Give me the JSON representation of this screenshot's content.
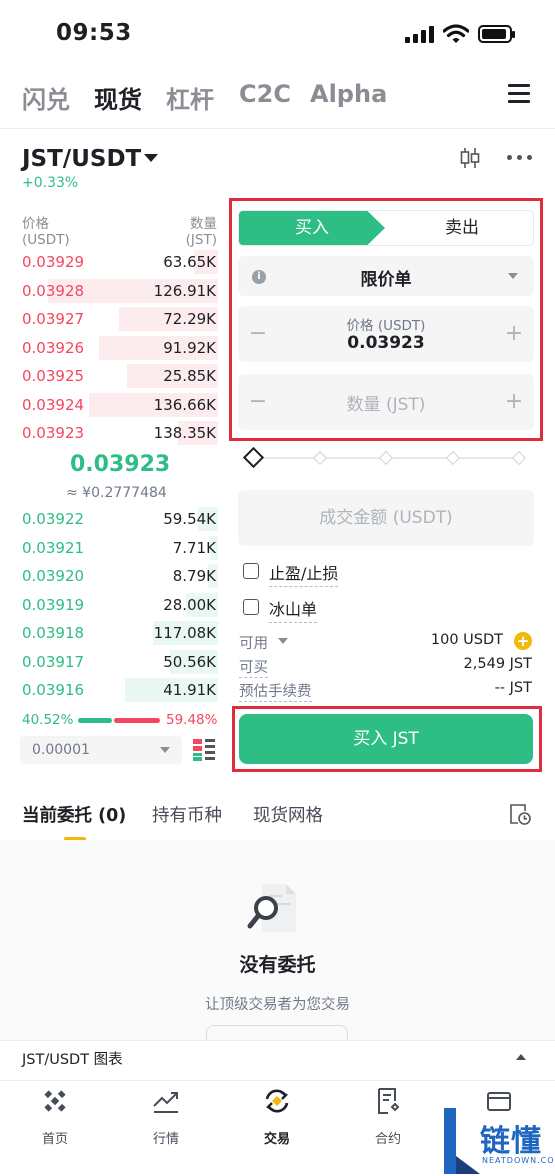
{
  "status_bar": {
    "time": "09:53"
  },
  "top_tabs": [
    "闪兑",
    "现货",
    "杠杆",
    "C2C",
    "Alpha"
  ],
  "pair": {
    "symbol": "JST/USDT",
    "change": "+0.33%"
  },
  "orderbook": {
    "price_header": "价格",
    "price_unit": "(USDT)",
    "qty_header": "数量",
    "qty_unit": "(JST)",
    "asks": [
      {
        "price": "0.03929",
        "qty": "63.65K",
        "depth": 0.12
      },
      {
        "price": "0.03928",
        "qty": "126.91K",
        "depth": 0.86
      },
      {
        "price": "0.03927",
        "qty": "72.29K",
        "depth": 0.5
      },
      {
        "price": "0.03926",
        "qty": "91.92K",
        "depth": 0.6
      },
      {
        "price": "0.03925",
        "qty": "25.85K",
        "depth": 0.46
      },
      {
        "price": "0.03924",
        "qty": "136.66K",
        "depth": 0.65
      },
      {
        "price": "0.03923",
        "qty": "138.35K",
        "depth": 0.2
      }
    ],
    "mid_price": "0.03923",
    "mid_fiat": "≈ ¥0.2777484",
    "bids": [
      {
        "price": "0.03922",
        "qty": "59.54K",
        "depth": 0.1
      },
      {
        "price": "0.03921",
        "qty": "7.71K",
        "depth": 0.04
      },
      {
        "price": "0.03920",
        "qty": "8.79K",
        "depth": 0.05
      },
      {
        "price": "0.03919",
        "qty": "28.00K",
        "depth": 0.16
      },
      {
        "price": "0.03918",
        "qty": "117.08K",
        "depth": 0.33
      },
      {
        "price": "0.03917",
        "qty": "50.56K",
        "depth": 0.24
      },
      {
        "price": "0.03916",
        "qty": "41.91K",
        "depth": 0.47
      }
    ],
    "buy_ratio": "40.52%",
    "sell_ratio": "59.48%",
    "precision": "0.00001"
  },
  "order_form": {
    "buy_tab": "买入",
    "sell_tab": "卖出",
    "order_type": "限价单",
    "price_label": "价格 (USDT)",
    "price_value": "0.03923",
    "qty_placeholder": "数量 (JST)",
    "total_placeholder": "成交金额 (USDT)",
    "tp_sl_label": "止盈/止损",
    "iceberg_label": "冰山单",
    "available_label": "可用",
    "available_value": "100 USDT",
    "can_buy_label": "可买",
    "can_buy_value": "2,549 JST",
    "fee_label": "预估手续费",
    "fee_value": "-- JST",
    "buy_button": "买入 JST",
    "minus": "−",
    "plus": "+"
  },
  "orders": {
    "tabs": [
      "当前委托 (0)",
      "持有币种",
      "现货网格"
    ],
    "empty_title": "没有委托",
    "empty_subtitle": "让顶级交易者为您交易"
  },
  "chart_bar": {
    "label": "JST/USDT 图表"
  },
  "bottom_nav": [
    "首页",
    "行情",
    "交易",
    "合约",
    ""
  ],
  "watermark": {
    "text": "链懂",
    "sub": "NEATDOWN.COM"
  },
  "colors": {
    "green": "#2ebd85",
    "red": "#f6465d",
    "yellow": "#f0b90b",
    "highlight_border": "#e02d3c"
  }
}
